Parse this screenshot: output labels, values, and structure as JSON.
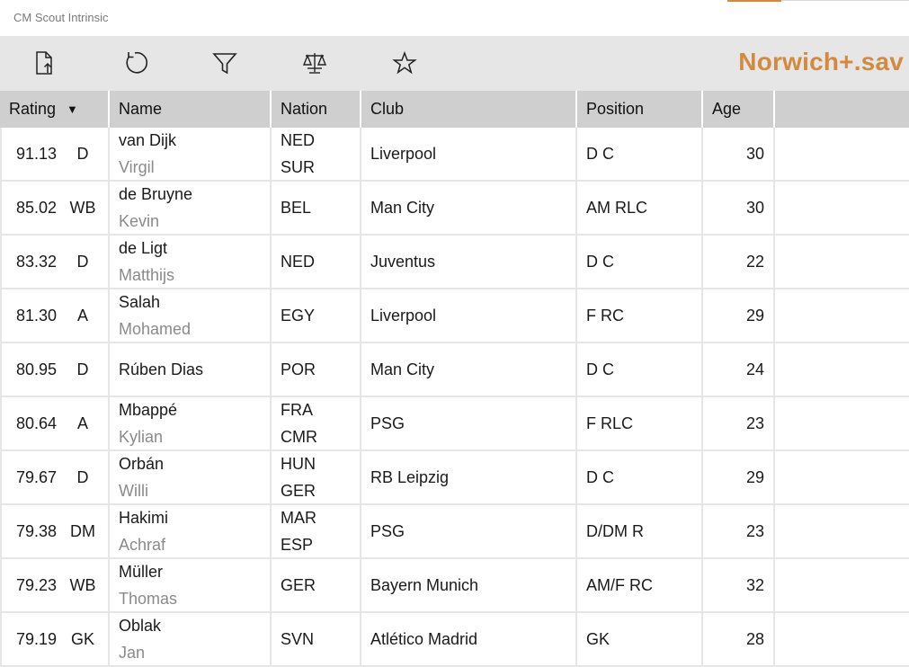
{
  "app": {
    "title": "CM Scout Intrinsic"
  },
  "toolbar": {
    "save_name": "Norwich+.sav",
    "buttons": [
      {
        "icon": "export-file-icon"
      },
      {
        "icon": "refresh-icon"
      },
      {
        "icon": "filter-icon"
      },
      {
        "icon": "compare-scale-icon"
      },
      {
        "icon": "star-icon"
      }
    ]
  },
  "colors": {
    "accent": "#d38a3e",
    "toolbar_bg": "#e6e6e6",
    "header_bg": "#cfcfcf"
  },
  "table": {
    "headers": {
      "rating": "Rating",
      "name": "Name",
      "nation": "Nation",
      "club": "Club",
      "position": "Position",
      "age": "Age"
    },
    "sort_indicator": "▼",
    "rows": [
      {
        "rating": "91.13",
        "role": "D",
        "surname": "van Dijk",
        "firstname": "Virgil",
        "nation1": "NED",
        "nation2": "SUR",
        "club": "Liverpool",
        "position": "D C",
        "age": "30"
      },
      {
        "rating": "85.02",
        "role": "WB",
        "surname": "de Bruyne",
        "firstname": "Kevin",
        "nation1": "BEL",
        "nation2": "",
        "club": "Man City",
        "position": "AM RLC",
        "age": "30"
      },
      {
        "rating": "83.32",
        "role": "D",
        "surname": "de Ligt",
        "firstname": "Matthijs",
        "nation1": "NED",
        "nation2": "",
        "club": "Juventus",
        "position": "D C",
        "age": "22"
      },
      {
        "rating": "81.30",
        "role": "A",
        "surname": "Salah",
        "firstname": "Mohamed",
        "nation1": "EGY",
        "nation2": "",
        "club": "Liverpool",
        "position": "F RC",
        "age": "29"
      },
      {
        "rating": "80.95",
        "role": "D",
        "surname": "Rúben Dias",
        "firstname": "",
        "nation1": "POR",
        "nation2": "",
        "club": "Man City",
        "position": "D C",
        "age": "24"
      },
      {
        "rating": "80.64",
        "role": "A",
        "surname": "Mbappé",
        "firstname": "Kylian",
        "nation1": "FRA",
        "nation2": "CMR",
        "club": "PSG",
        "position": "F RLC",
        "age": "23"
      },
      {
        "rating": "79.67",
        "role": "D",
        "surname": "Orbán",
        "firstname": "Willi",
        "nation1": "HUN",
        "nation2": "GER",
        "club": "RB Leipzig",
        "position": "D C",
        "age": "29"
      },
      {
        "rating": "79.38",
        "role": "DM",
        "surname": "Hakimi",
        "firstname": "Achraf",
        "nation1": "MAR",
        "nation2": "ESP",
        "club": "PSG",
        "position": "D/DM R",
        "age": "23"
      },
      {
        "rating": "79.23",
        "role": "WB",
        "surname": "Müller",
        "firstname": "Thomas",
        "nation1": "GER",
        "nation2": "",
        "club": "Bayern Munich",
        "position": "AM/F RC",
        "age": "32"
      },
      {
        "rating": "79.19",
        "role": "GK",
        "surname": "Oblak",
        "firstname": "Jan",
        "nation1": "SVN",
        "nation2": "",
        "club": "Atlético Madrid",
        "position": "GK",
        "age": "28"
      }
    ]
  }
}
